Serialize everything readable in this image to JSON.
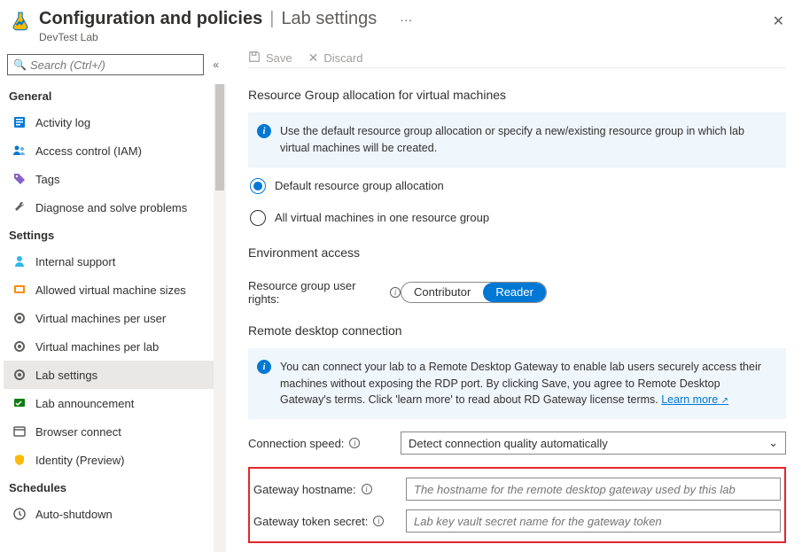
{
  "header": {
    "title_main": "Configuration and policies",
    "title_sub": "Lab settings",
    "breadcrumb": "DevTest Lab",
    "dots": "···"
  },
  "search": {
    "placeholder": "Search (Ctrl+/)"
  },
  "nav": {
    "groups": [
      {
        "label": "General",
        "items": [
          {
            "icon": "log",
            "label": "Activity log"
          },
          {
            "icon": "iam",
            "label": "Access control (IAM)"
          },
          {
            "icon": "tag",
            "label": "Tags"
          },
          {
            "icon": "wrench",
            "label": "Diagnose and solve problems"
          }
        ]
      },
      {
        "label": "Settings",
        "items": [
          {
            "icon": "person",
            "label": "Internal support"
          },
          {
            "icon": "sizes",
            "label": "Allowed virtual machine sizes"
          },
          {
            "icon": "gear",
            "label": "Virtual machines per user"
          },
          {
            "icon": "gear",
            "label": "Virtual machines per lab"
          },
          {
            "icon": "gear",
            "label": "Lab settings",
            "selected": true
          },
          {
            "icon": "ann",
            "label": "Lab announcement"
          },
          {
            "icon": "browser",
            "label": "Browser connect"
          },
          {
            "icon": "identity",
            "label": "Identity (Preview)"
          }
        ]
      },
      {
        "label": "Schedules",
        "items": [
          {
            "icon": "clock",
            "label": "Auto-shutdown"
          }
        ]
      }
    ]
  },
  "toolbar": {
    "save": "Save",
    "discard": "Discard"
  },
  "sections": {
    "rg_title": "Resource Group allocation for virtual machines",
    "rg_info": "Use the default resource group allocation or specify a new/existing resource group in which lab virtual machines will be created.",
    "rg_opt_default": "Default resource group allocation",
    "rg_opt_one": "All virtual machines in one resource group",
    "env_title": "Environment access",
    "env_label": "Resource group user rights:",
    "env_contrib": "Contributor",
    "env_reader": "Reader",
    "rdp_title": "Remote desktop connection",
    "rdp_info_a": "You can connect your lab to a Remote Desktop Gateway to enable lab users securely access their machines without exposing the RDP port. By clicking Save, you agree to Remote Desktop Gateway's terms.  Click 'learn more' to read about RD Gateway license terms. ",
    "rdp_learn": "Learn more",
    "conn_label": "Connection speed:",
    "conn_value": "Detect connection quality automatically",
    "gw_host_label": "Gateway hostname:",
    "gw_host_placeholder": "The hostname for the remote desktop gateway used by this lab",
    "gw_token_label": "Gateway token secret:",
    "gw_token_placeholder": "Lab key vault secret name for the gateway token"
  }
}
